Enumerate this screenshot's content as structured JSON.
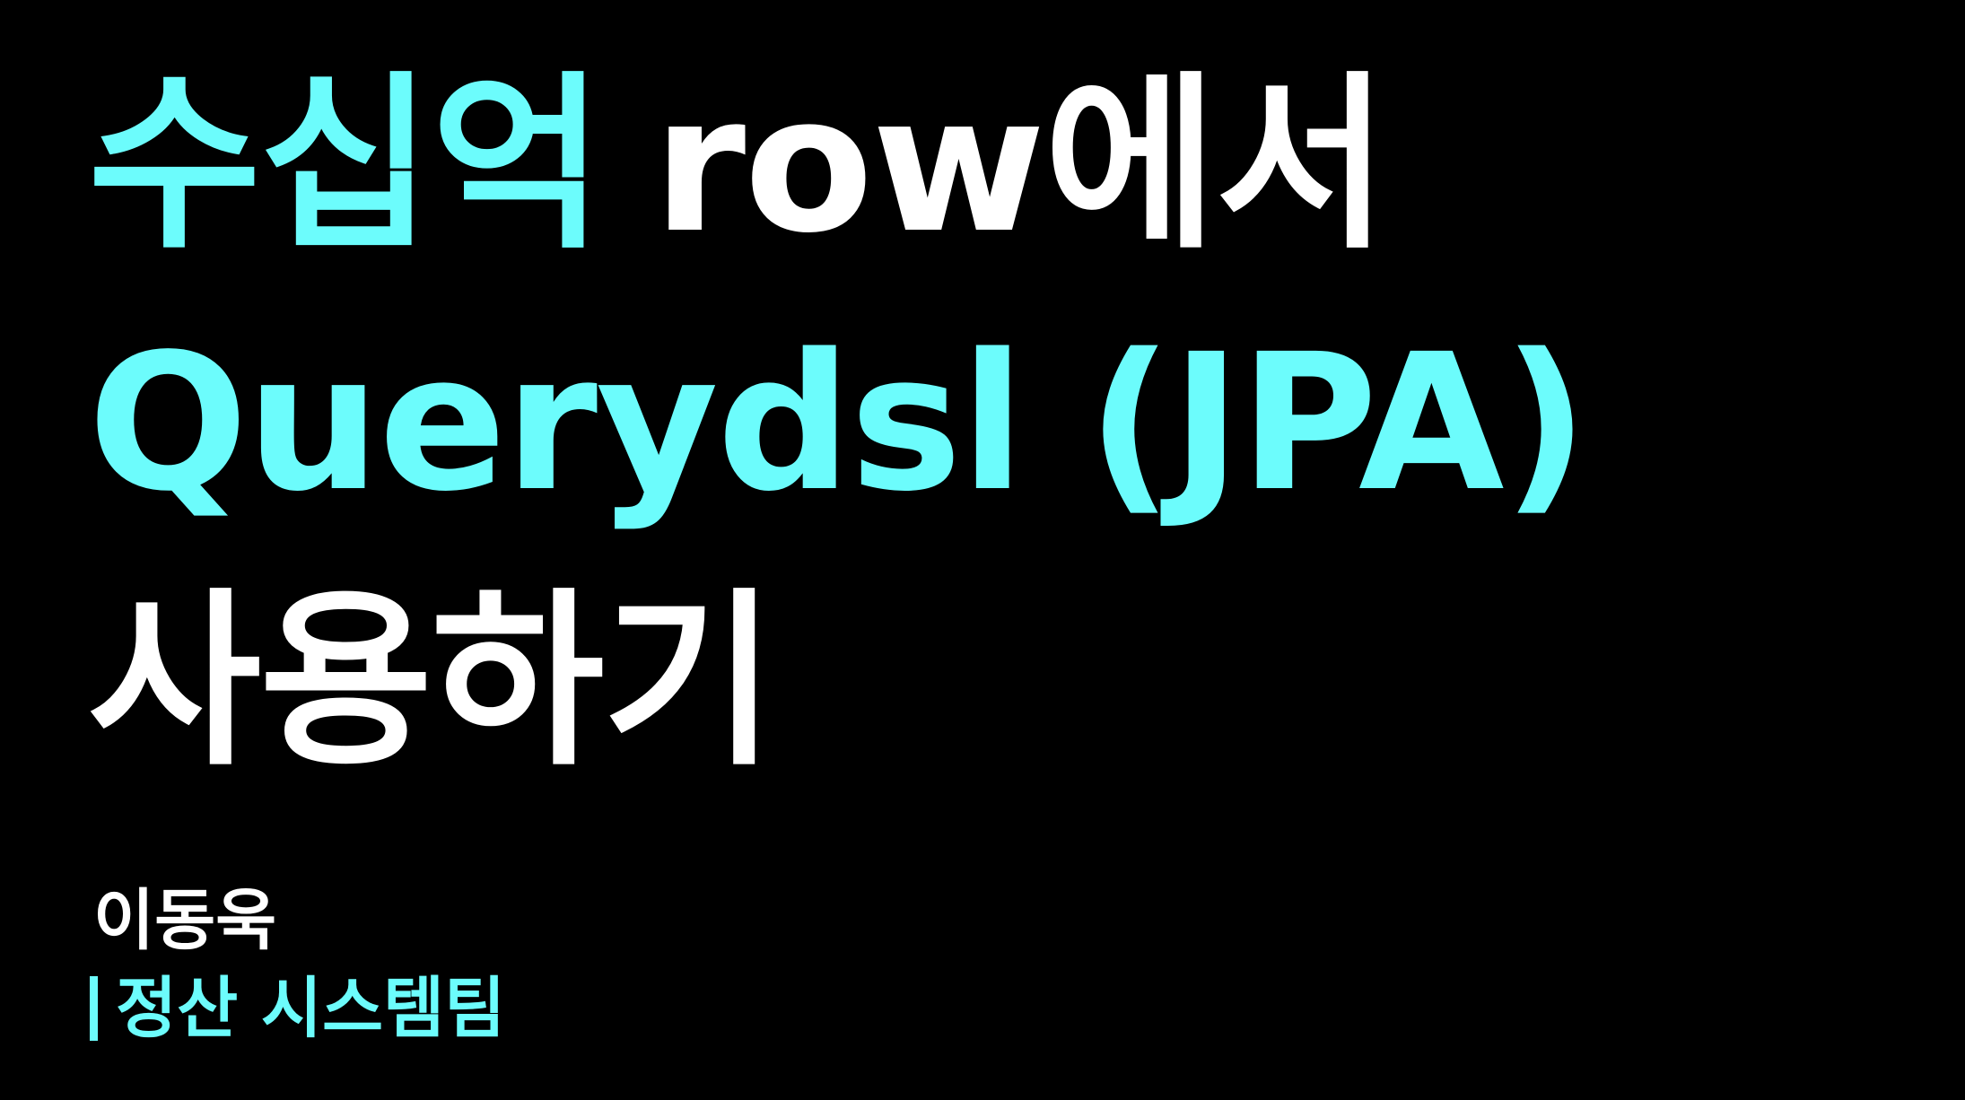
{
  "colors": {
    "background": "#000000",
    "accent": "#6cfcfc",
    "text": "#ffffff"
  },
  "title": {
    "line1_accent": "수십억",
    "line1_rest": "row에서",
    "line2": "Querydsl (JPA)",
    "line3": "사용하기"
  },
  "presenter": {
    "name": "이동욱",
    "team": "정산 시스템팀"
  }
}
